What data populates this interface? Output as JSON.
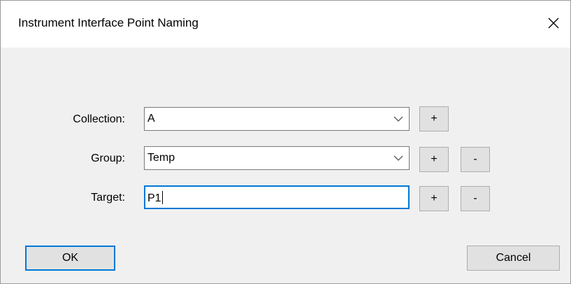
{
  "dialog": {
    "title": "Instrument Interface Point Naming",
    "close_icon": "close-icon"
  },
  "form": {
    "collection": {
      "label": "Collection:",
      "value": "A"
    },
    "group": {
      "label": "Group:",
      "value": "Temp"
    },
    "target": {
      "label": "Target:",
      "value": "P1"
    }
  },
  "buttons": {
    "add": "+",
    "remove": "-",
    "ok": "OK",
    "cancel": "Cancel"
  },
  "colors": {
    "focus_accent": "#0078d7",
    "dialog_background": "#f0f0f0",
    "titlebar_background": "#ffffff",
    "button_face": "#e1e1e1"
  }
}
